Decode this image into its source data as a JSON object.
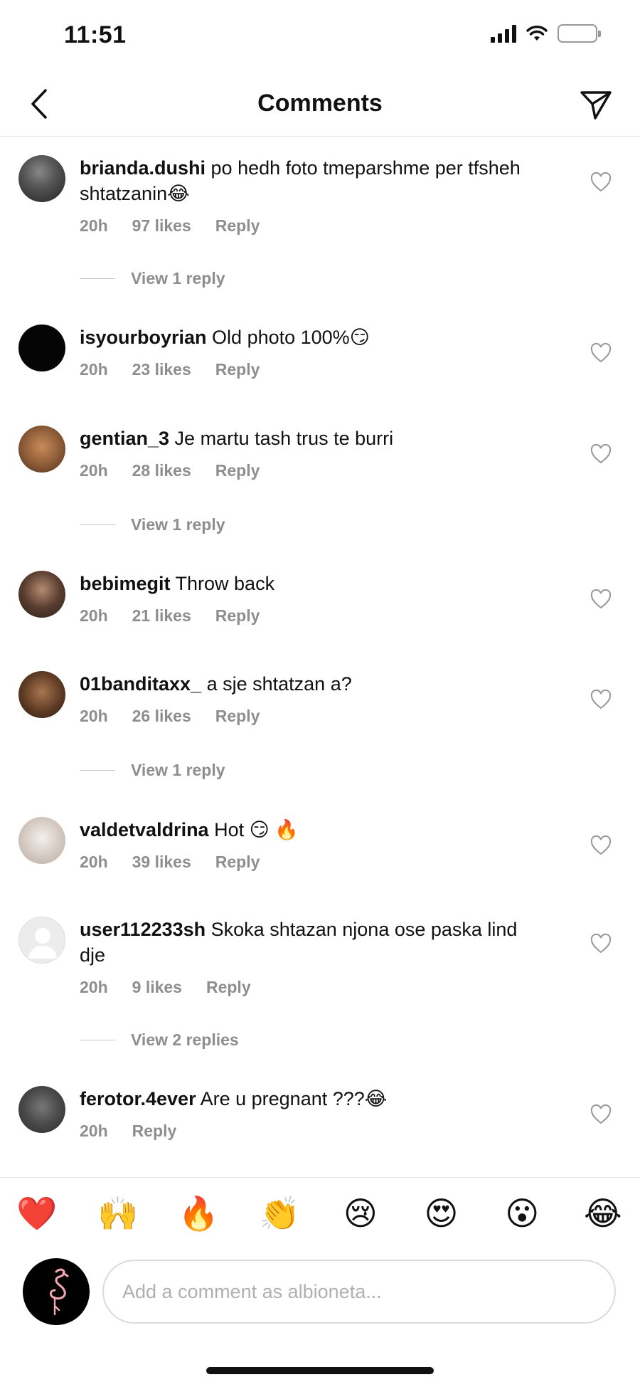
{
  "status_bar": {
    "time": "11:51"
  },
  "header": {
    "title": "Comments"
  },
  "comments": [
    {
      "username": "brianda.dushi",
      "text": " po hedh foto tmeparshme per tfsheh shtatzanin😂",
      "time": "20h",
      "likes": "97 likes",
      "reply": "Reply",
      "view_replies": "View 1 reply"
    },
    {
      "username": "isyourboyrian",
      "text": " Old photo 100%😏",
      "time": "20h",
      "likes": "23 likes",
      "reply": "Reply"
    },
    {
      "username": "gentian_3",
      "text": " Je martu tash trus te burri",
      "time": "20h",
      "likes": "28 likes",
      "reply": "Reply",
      "view_replies": "View 1 reply"
    },
    {
      "username": "bebimegit",
      "text": " Throw back",
      "time": "20h",
      "likes": "21 likes",
      "reply": "Reply"
    },
    {
      "username": "01banditaxx_",
      "text": " a sje shtatzan a?",
      "time": "20h",
      "likes": "26 likes",
      "reply": "Reply",
      "view_replies": "View 1 reply"
    },
    {
      "username": "valdetvaldrina",
      "text": " Hot 😏 🔥",
      "time": "20h",
      "likes": "39 likes",
      "reply": "Reply"
    },
    {
      "username": "user112233sh",
      "text": " Skoka shtazan njona ose paska lind dje",
      "time": "20h",
      "likes": "9 likes",
      "reply": "Reply",
      "view_replies": "View 2 replies"
    },
    {
      "username": "ferotor.4ever",
      "text": " Are u pregnant ???😂",
      "time": "20h",
      "likes": "",
      "reply": "Reply"
    }
  ],
  "emoji_bar": [
    "❤️",
    "🙌",
    "🔥",
    "👏",
    "😢",
    "😍",
    "😮",
    "😂"
  ],
  "comment_input": {
    "placeholder": "Add a comment as albioneta..."
  },
  "colors": {
    "secondary_text": "#8e8e8e",
    "heart_red": "#ed4956"
  }
}
